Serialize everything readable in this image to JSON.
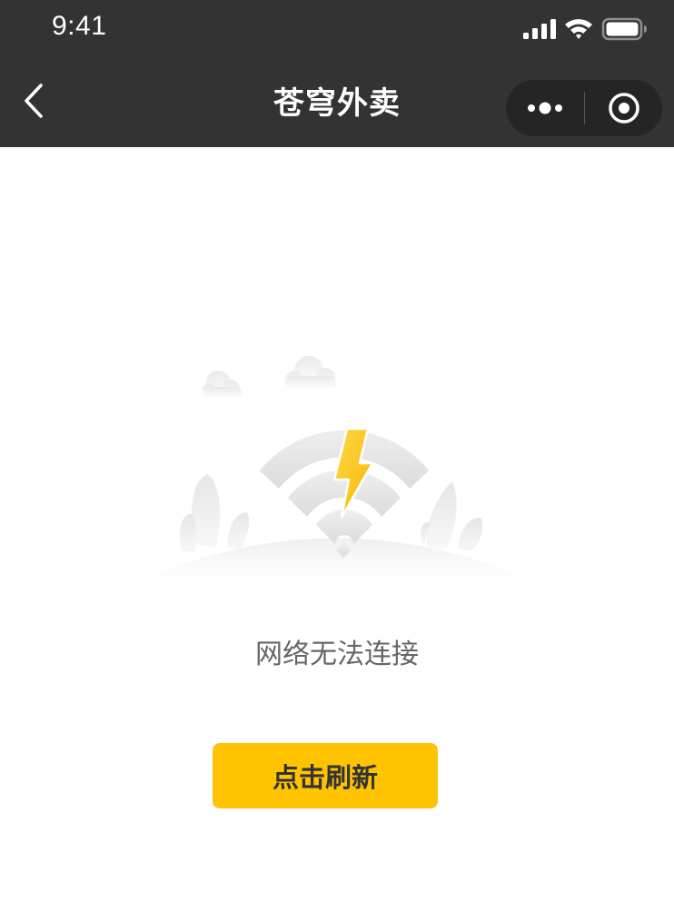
{
  "status_bar": {
    "time": "9:41"
  },
  "nav": {
    "title": "苍穹外卖"
  },
  "icons": {
    "back": "chevron-left-icon",
    "more": "more-dots-icon",
    "close": "target-close-icon",
    "illustration": "network-error-icon"
  },
  "error": {
    "message": "网络无法连接"
  },
  "action": {
    "refresh_label": "点击刷新"
  },
  "colors": {
    "nav_background": "#333333",
    "accent": "#ffc300",
    "message_text": "#666666",
    "button_text": "#333333"
  }
}
